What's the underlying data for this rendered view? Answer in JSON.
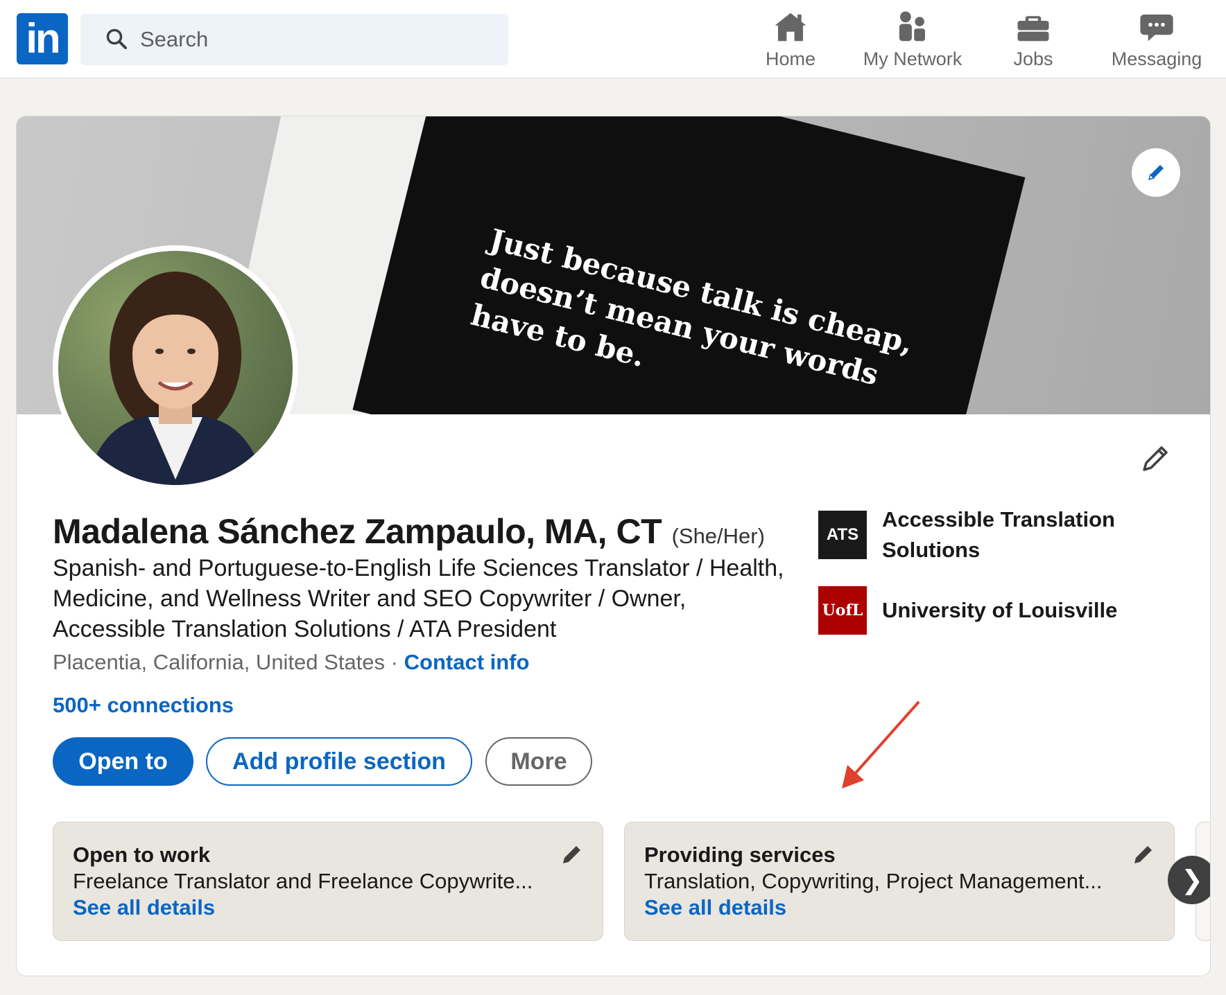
{
  "nav": {
    "logo_text": "in",
    "search_placeholder": "Search",
    "items": [
      {
        "label": "Home",
        "icon": "home-icon"
      },
      {
        "label": "My Network",
        "icon": "network-icon"
      },
      {
        "label": "Jobs",
        "icon": "jobs-icon"
      },
      {
        "label": "Messaging",
        "icon": "messaging-icon"
      }
    ]
  },
  "banner": {
    "quote": "Just because talk is cheap,\ndoesn’t mean your words\nhave to be."
  },
  "profile": {
    "name": "Madalena Sánchez Zampaulo, MA, CT",
    "pronouns": "(She/Her)",
    "headline": "Spanish- and Portuguese-to-English Life Sciences Translator / Health, Medicine, and Wellness Writer and SEO Copywriter / Owner, Accessible Translation Solutions / ATA President",
    "location": "Placentia, California, United States",
    "separator": "·",
    "contact_info": "Contact info",
    "connections": "500+ connections"
  },
  "orgs": [
    {
      "logo_text": "ATS",
      "name": "Accessible Translation Solutions",
      "color": "#1a1a1a"
    },
    {
      "logo_text": "UofL",
      "name": "University of Louisville",
      "color": "#ad0000"
    }
  ],
  "buttons": {
    "open_to": "Open to",
    "add_section": "Add profile section",
    "more": "More"
  },
  "services": [
    {
      "title": "Open to work",
      "desc": "Freelance Translator and Freelance Copywrite...",
      "link": "See all details"
    },
    {
      "title": "Providing services",
      "desc": "Translation, Copywriting, Project Management...",
      "link": "See all details"
    }
  ],
  "carousel": {
    "next": "❯"
  },
  "colors": {
    "brand": "#0a66c2",
    "annotation_arrow": "#e0402e"
  }
}
